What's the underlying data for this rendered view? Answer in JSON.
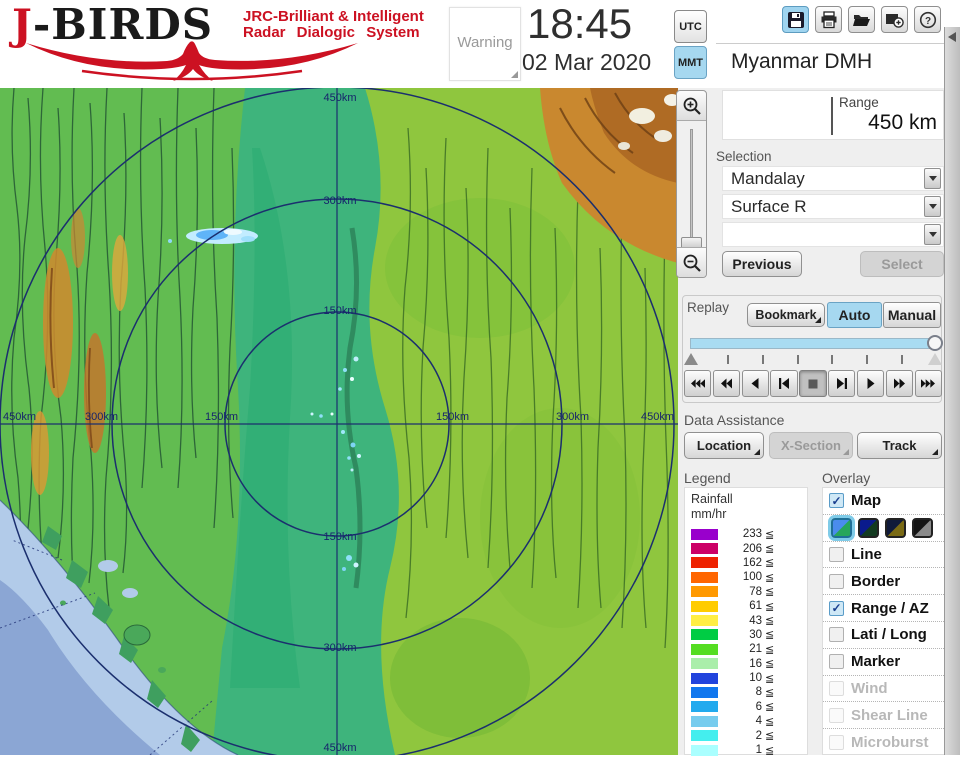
{
  "header": {
    "logo": {
      "title_j": "J",
      "title_rest": "-BIRDS",
      "subtitle_line1": "JRC-Brilliant & Intelligent",
      "subtitle_line2": "Radar Dialogic System"
    },
    "warning_label": "Warning",
    "clock": {
      "time": "18:45",
      "date": "02 Mar 2020"
    },
    "timezone": {
      "utc": "UTC",
      "mmt": "MMT",
      "selected": "MMT"
    }
  },
  "station": {
    "name": "Myanmar DMH",
    "range_label": "Range",
    "range_value": "450 km"
  },
  "selection": {
    "label": "Selection",
    "dropdown1": "Mandalay",
    "dropdown2": "Surface R",
    "dropdown3": "",
    "previous_label": "Previous",
    "select_label": "Select"
  },
  "replay": {
    "label": "Replay",
    "bookmark_label": "Bookmark",
    "auto_label": "Auto",
    "manual_label": "Manual",
    "mode": "Auto"
  },
  "data_assistance": {
    "label": "Data Assistance",
    "buttons": [
      {
        "label": "Location",
        "enabled": true
      },
      {
        "label": "X-Section",
        "enabled": false
      },
      {
        "label": "Track",
        "enabled": true
      }
    ]
  },
  "legend": {
    "label": "Legend",
    "title_line1": "Rainfall",
    "title_line2": "mm/hr",
    "suffix": "≦",
    "entries": [
      {
        "value": "233",
        "color": "#9900cc"
      },
      {
        "value": "206",
        "color": "#cc0066"
      },
      {
        "value": "162",
        "color": "#ee2200"
      },
      {
        "value": "100",
        "color": "#ff6600"
      },
      {
        "value": "78",
        "color": "#ff9900"
      },
      {
        "value": "61",
        "color": "#ffcc00"
      },
      {
        "value": "43",
        "color": "#ffee44"
      },
      {
        "value": "30",
        "color": "#00cc44"
      },
      {
        "value": "21",
        "color": "#55dd22"
      },
      {
        "value": "16",
        "color": "#aaeeaa"
      },
      {
        "value": "10",
        "color": "#2244dd"
      },
      {
        "value": "8",
        "color": "#1177ee"
      },
      {
        "value": "6",
        "color": "#22aaee"
      },
      {
        "value": "4",
        "color": "#77ccee"
      },
      {
        "value": "2",
        "color": "#44eeee"
      },
      {
        "value": "1",
        "color": "#aaffff"
      }
    ]
  },
  "overlay": {
    "label": "Overlay",
    "items": [
      {
        "key": "map",
        "label": "Map",
        "checked": true,
        "enabled": true,
        "styles_after": true
      },
      {
        "key": "line",
        "label": "Line",
        "checked": false,
        "enabled": true
      },
      {
        "key": "border",
        "label": "Border",
        "checked": false,
        "enabled": true
      },
      {
        "key": "range-az",
        "label": "Range / AZ",
        "checked": true,
        "enabled": true
      },
      {
        "key": "lati-long",
        "label": "Lati / Long",
        "checked": false,
        "enabled": true
      },
      {
        "key": "marker",
        "label": "Marker",
        "checked": false,
        "enabled": true
      },
      {
        "key": "wind",
        "label": "Wind",
        "checked": false,
        "enabled": false
      },
      {
        "key": "shear-line",
        "label": "Shear Line",
        "checked": false,
        "enabled": false
      },
      {
        "key": "microburst",
        "label": "Microburst",
        "checked": false,
        "enabled": false
      }
    ],
    "map_styles": [
      {
        "top": "#4a8ced",
        "bottom": "#27a65a",
        "selected": true
      },
      {
        "top": "#0a1a8c",
        "bottom": "#123a20",
        "selected": false
      },
      {
        "top": "#101a3a",
        "bottom": "#7a6a14",
        "selected": false
      },
      {
        "top": "#141414",
        "bottom": "#8a8a8a",
        "selected": false
      }
    ]
  },
  "map": {
    "ring_labels": {
      "r150": "150km",
      "r300": "300km",
      "r450": "450km"
    },
    "accent_ring_color": "#1b2f6e",
    "echo_color": "#8fe0f8"
  },
  "colors": {
    "accent_blue": "#a6d8f0",
    "brand_red": "#cc1122",
    "panel_gray": "#efefef"
  }
}
